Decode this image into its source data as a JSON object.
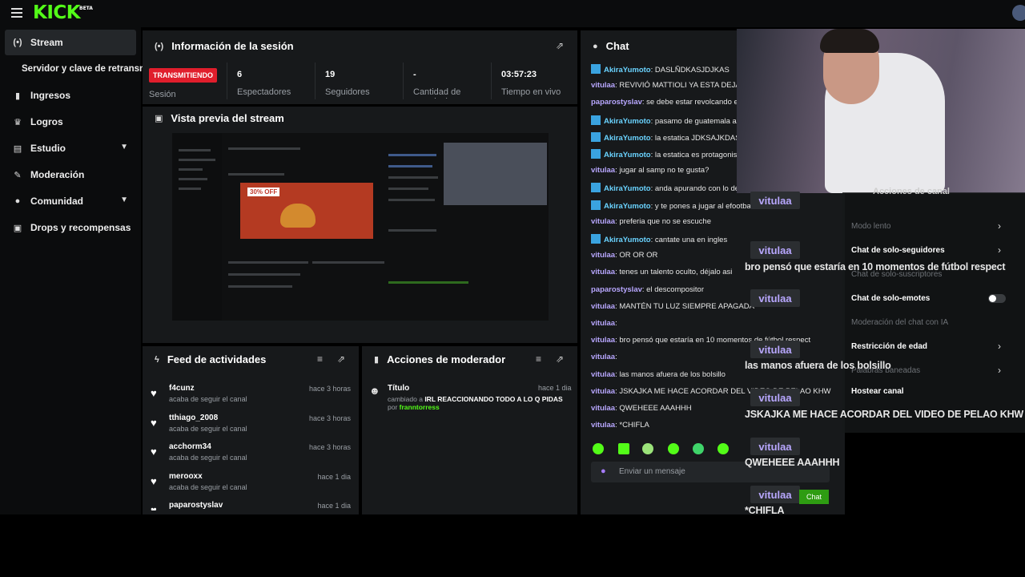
{
  "brand": {
    "logo": "KICK",
    "logo_sup": "BETA"
  },
  "sidebar": {
    "items": [
      {
        "label": "Stream",
        "icon": "stream-icon"
      },
      {
        "label": "Servidor y clave de retransn",
        "icon": ""
      },
      {
        "label": "Ingresos",
        "icon": "chart-icon"
      },
      {
        "label": "Logros",
        "icon": "trophy-icon"
      },
      {
        "label": "Estudio",
        "icon": "layout-icon"
      },
      {
        "label": "Moderación",
        "icon": "wrench-icon"
      },
      {
        "label": "Comunidad",
        "icon": "people-icon"
      },
      {
        "label": "Drops y recompensas",
        "icon": "gift-icon"
      }
    ]
  },
  "session": {
    "title": "Información de la sesión",
    "status": "TRANSMITIENDO",
    "status_label": "Sesión",
    "viewers_value": "6",
    "viewers_label": "Espectadores",
    "followers_value": "19",
    "followers_label": "Seguidores",
    "subs_value": "-",
    "subs_label": "Cantidad de suscripciones",
    "live_time_value": "03:57:23",
    "live_time_label": "Tiempo en vivo"
  },
  "preview": {
    "title": "Vista previa del stream",
    "promo_tag": "30% OFF"
  },
  "feed": {
    "title": "Feed de actividades",
    "items": [
      {
        "name": "f4cunz",
        "sub": "acaba de seguir el canal",
        "time": "hace 3 horas"
      },
      {
        "name": "tthiago_2008",
        "sub": "acaba de seguir el canal",
        "time": "hace 3 horas"
      },
      {
        "name": "acchorm34",
        "sub": "acaba de seguir el canal",
        "time": "hace 3 horas"
      },
      {
        "name": "merooxx",
        "sub": "acaba de seguir el canal",
        "time": "hace 1 dia"
      },
      {
        "name": "paparostyslav",
        "sub": "",
        "time": "hace 1 dia"
      }
    ]
  },
  "mod_actions": {
    "title": "Acciones de moderador",
    "item_title": "Título",
    "item_time": "hace 1 dia",
    "item_desc_prefix": "cambiado a ",
    "item_desc_value": "IRL REACCIONANDO TODO A LO Q PIDAS",
    "item_by_prefix": "por ",
    "item_by": "franntorress"
  },
  "chat": {
    "title": "Chat",
    "input_placeholder": "Enviar un mensaje",
    "messages": [
      {
        "user": "AkiraYumoto",
        "text": ": DASLÑDKASJDJKAS",
        "color": "#6ad3ff",
        "bot": true
      },
      {
        "user": "vitulaa",
        "text": ": REVIVIÓ MATTIOLI YA ESTA DEJA I",
        "color": "#b8a7ff",
        "bot": false
      },
      {
        "user": "paparostyslav",
        "text": ": se debe estar revolcando e",
        "color": "#b8a7ff",
        "bot": false
      },
      {
        "user": "AkiraYumoto",
        "text": ": pasamo de guatemala a g",
        "color": "#6ad3ff",
        "bot": true
      },
      {
        "user": "AkiraYumoto",
        "text": ": la estatica JDKSAJKDASI",
        "color": "#6ad3ff",
        "bot": true
      },
      {
        "user": "AkiraYumoto",
        "text": ": la estatica es protagonist",
        "color": "#6ad3ff",
        "bot": true
      },
      {
        "user": "vitulaa",
        "text": ": jugar al samp no te gusta?",
        "color": "#b8a7ff",
        "bot": false
      },
      {
        "user": "AkiraYumoto",
        "text": ": anda apurando con lo del",
        "color": "#6ad3ff",
        "bot": true
      },
      {
        "user": "AkiraYumoto",
        "text": ": y te pones a jugar al efootbal",
        "color": "#6ad3ff",
        "bot": true
      },
      {
        "user": "vitulaa",
        "text": ": preferia que no se escuche",
        "color": "#b8a7ff",
        "bot": false
      },
      {
        "user": "AkiraYumoto",
        "text": ": cantate una en ingles",
        "color": "#6ad3ff",
        "bot": true
      },
      {
        "user": "vitulaa",
        "text": ": OR OR OR",
        "color": "#b8a7ff",
        "bot": false
      },
      {
        "user": "vitulaa",
        "text": ": tenes un talento oculto, déjalo asi",
        "color": "#b8a7ff",
        "bot": false
      },
      {
        "user": "paparostyslav",
        "text": ": el descompositor",
        "color": "#b8a7ff",
        "bot": false
      },
      {
        "user": "vitulaa",
        "text": ": MANTÉN TU LUZ SIEMPRE APAGADA",
        "color": "#b8a7ff",
        "bot": false
      },
      {
        "user": "vitulaa",
        "text": ":",
        "color": "#b8a7ff",
        "bot": false
      },
      {
        "user": "vitulaa",
        "text": ": bro pensó que estaría en 10 momentos de fútbol respect",
        "color": "#b8a7ff",
        "bot": false
      },
      {
        "user": "vitulaa",
        "text": ":",
        "color": "#b8a7ff",
        "bot": false
      },
      {
        "user": "vitulaa",
        "text": ": las manos afuera de los bolsillo",
        "color": "#b8a7ff",
        "bot": false
      },
      {
        "user": "vitulaa",
        "text": ": JSKAJKA ME HACE ACORDAR DEL VIDEO DE PELAO KHW",
        "color": "#b8a7ff",
        "bot": false
      },
      {
        "user": "vitulaa",
        "text": ": QWEHEEE AAAHHH",
        "color": "#b8a7ff",
        "bot": false
      },
      {
        "user": "vitulaa",
        "text": ": *CHIFLA",
        "color": "#b8a7ff",
        "bot": false
      }
    ]
  },
  "mod_menu": {
    "title": "Acciones de canal",
    "items": [
      {
        "label": "Modo lento",
        "dim": true,
        "arrow": true
      },
      {
        "label": "Chat de solo-seguidores",
        "dim": false,
        "arrow": true
      },
      {
        "label": "Chat de solo-suscriptores",
        "dim": true,
        "arrow": false
      },
      {
        "label": "Chat de solo-emotes",
        "dim": false,
        "arrow": false
      },
      {
        "label": "Moderación del chat con IA",
        "dim": true,
        "arrow": false
      },
      {
        "label": "Restricción de edad",
        "dim": false,
        "arrow": true
      },
      {
        "label": "Palabras baneadas",
        "dim": true,
        "arrow": true
      },
      {
        "label": "Hostear canal",
        "dim": false,
        "arrow": false
      }
    ]
  },
  "overlay_chat": {
    "user": "vitulaa",
    "messages": [
      "",
      "bro pensó que estaría en 10 momentos de fútbol respect",
      "",
      "las manos afuera de los bolsillo",
      "JSKAJKA ME HACE ACORDAR DEL VIDEO DE PELAO KHW",
      "QWEHEEE AAAHHH",
      "*CHIFLA"
    ],
    "chat_button": "Chat"
  },
  "colors": {
    "accent": "#53fc18",
    "live": "#e01e2c",
    "panel": "#17191b",
    "user": "#b8a7ff",
    "bot_user": "#6ad3ff"
  }
}
